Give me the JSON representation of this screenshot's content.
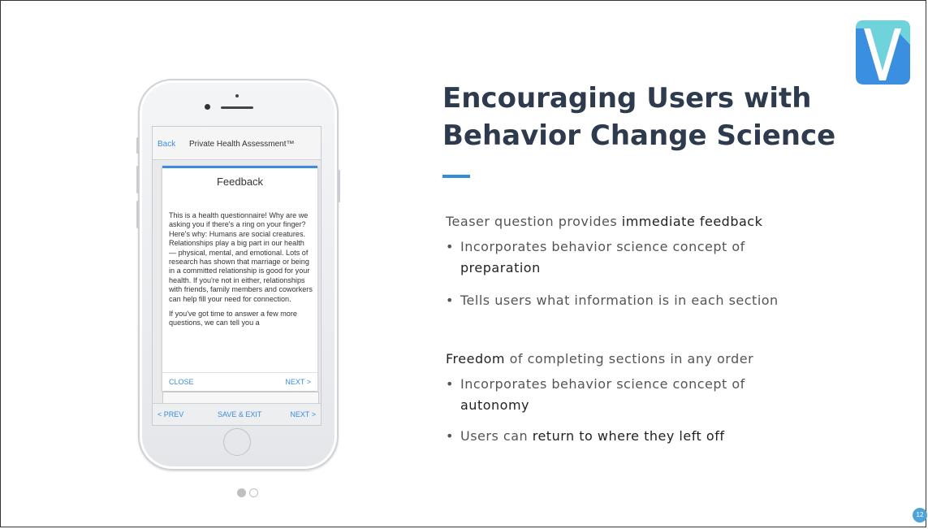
{
  "brand": {
    "logo_icon": "logo-v-icon",
    "logo_colors": [
      "#6fd3db",
      "#3b8fe0",
      "#ffffff"
    ]
  },
  "phone": {
    "nav": {
      "back_label": "Back",
      "title": "Private Health Assessment™"
    },
    "modal": {
      "title": "Feedback",
      "paragraph1": "This is a health questionnaire! Why are we asking you if there's a ring on your finger? Here's why: Humans are social creatures. Relationships play a big part in our health — physical, mental, and emotional. Lots of research has shown that marriage or being in a committed relationship is good for your health. If you're not in either, relationships with friends, family members and coworkers can help fill your need for connection.",
      "paragraph2": "If you've got time to answer a few more questions, we can tell you a",
      "close_label": "CLOSE",
      "next_label": "NEXT >"
    },
    "bottom_bar": {
      "prev_label": "< PREV",
      "save_label": "SAVE & EXIT",
      "next_label": "NEXT >"
    }
  },
  "carousel": {
    "current": 1,
    "total": 2
  },
  "slide": {
    "heading_line1": "Encouraging Users with",
    "heading_line2": "Behavior Change Science",
    "section1": {
      "lead_prefix": "Teaser question provides ",
      "lead_emph": "immediate feedback",
      "bullet1_prefix": "Incorporates behavior science concept of",
      "bullet1_emph": "preparation",
      "bullet2": "Tells users what information is in each section"
    },
    "section2": {
      "lead_emph": "Freedom",
      "lead_suffix": " of completing sections in any order",
      "bullet1_prefix": "Incorporates behavior science concept of",
      "bullet1_emph": "autonomy",
      "bullet2_prefix": "Users can ",
      "bullet2_emph": "return to where they left off"
    },
    "page_number": "12",
    "accent_color": "#2f8fd8"
  }
}
